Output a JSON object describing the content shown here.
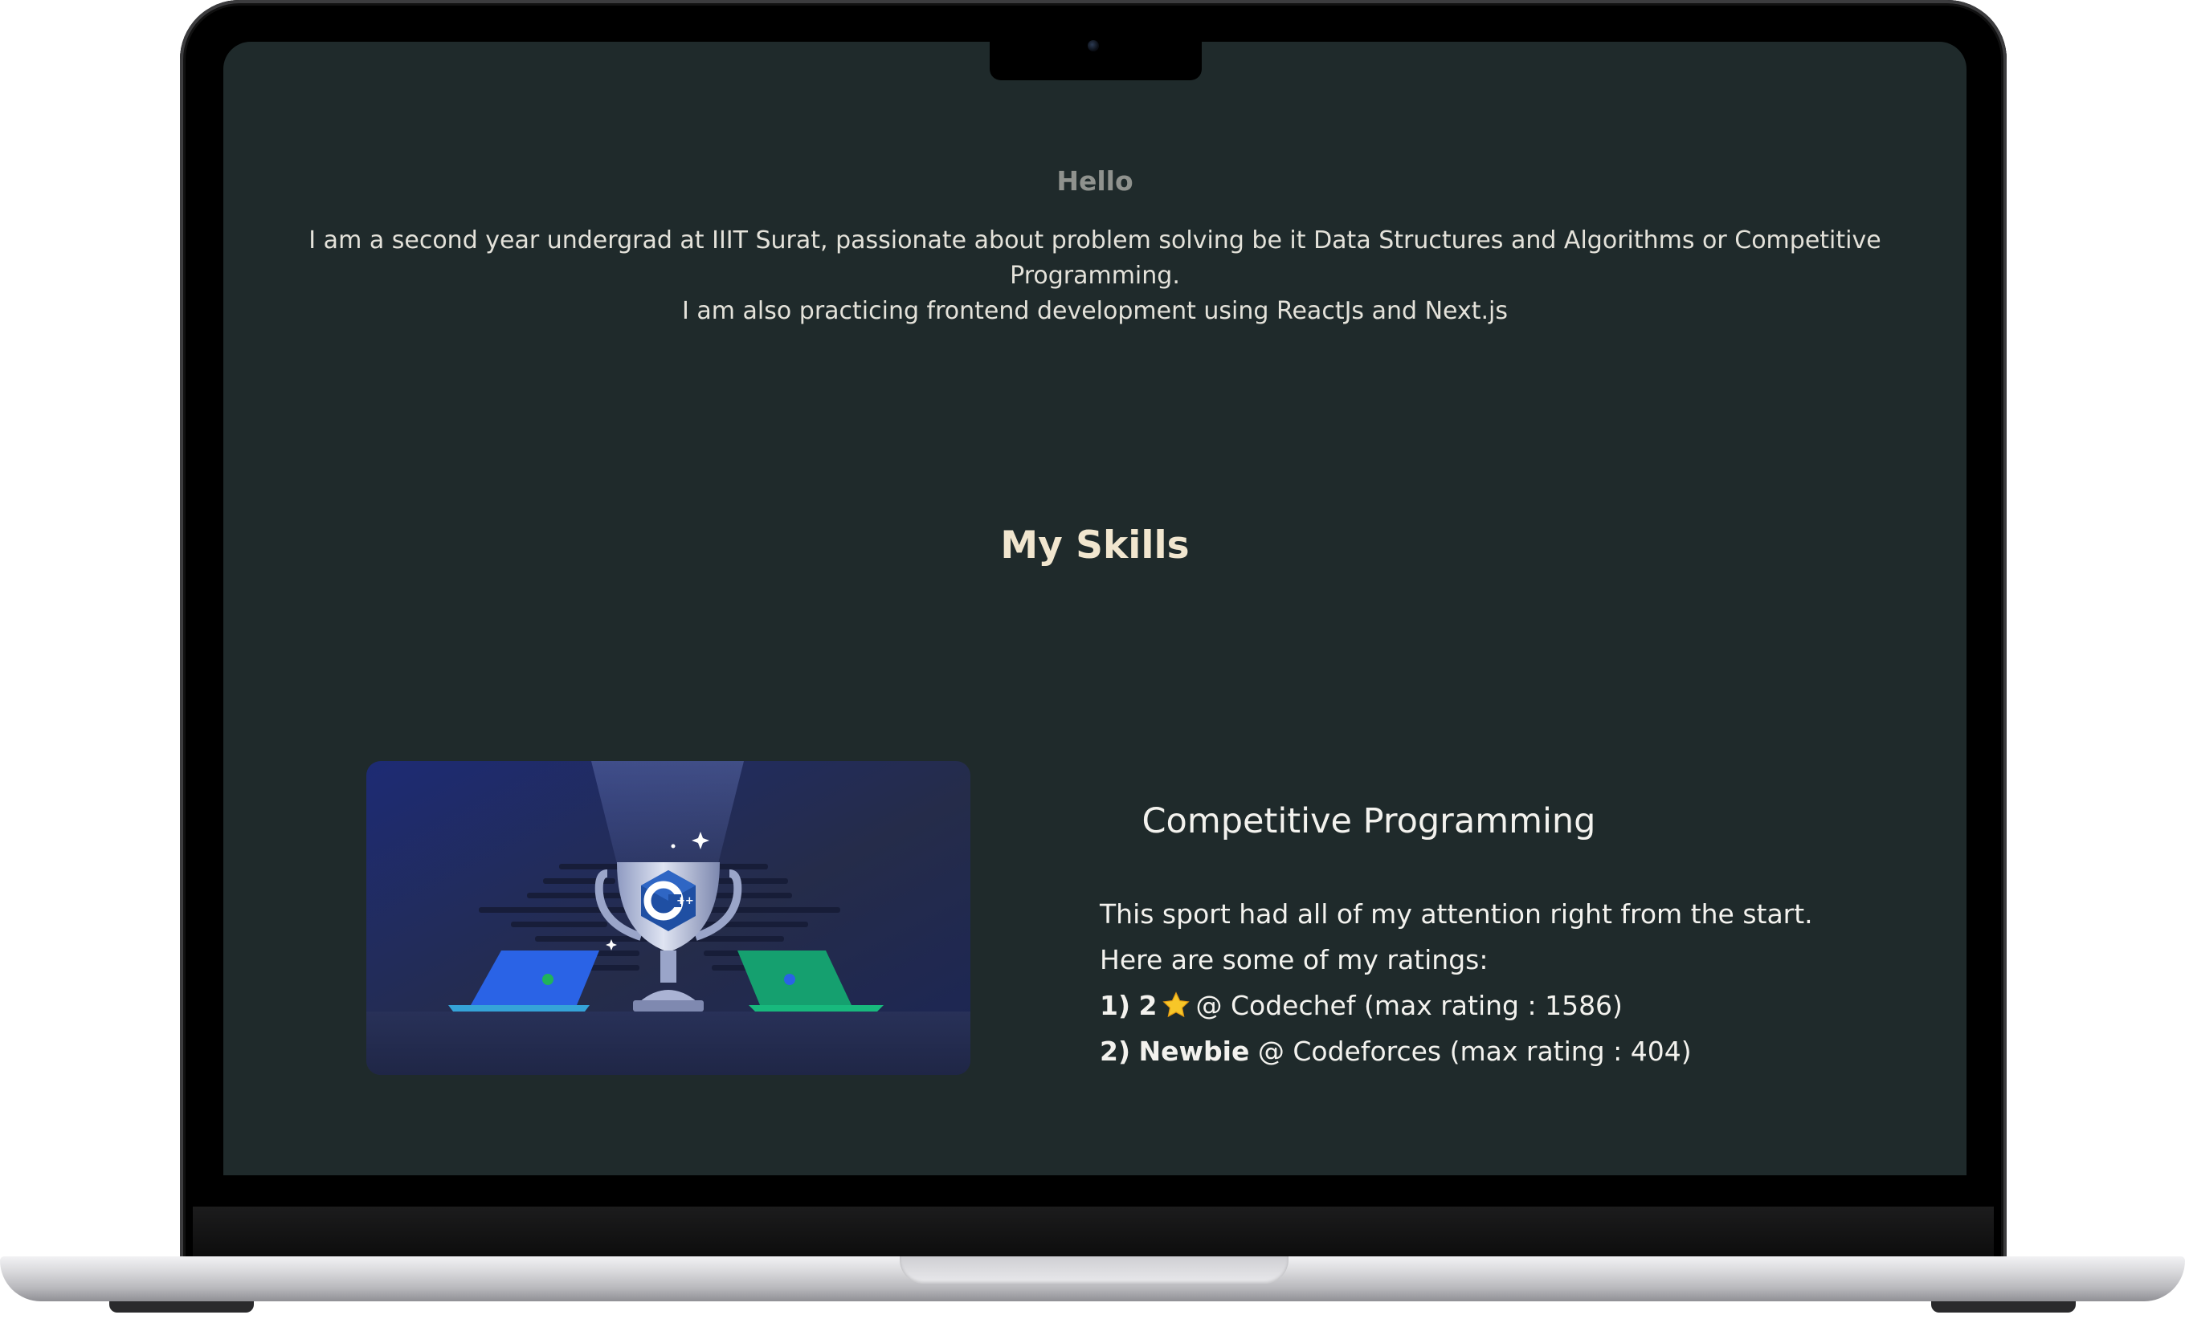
{
  "intro": {
    "heading": "Hello",
    "line1": "I am a second year undergrad at IIIT Surat, passionate about problem solving be it Data Structures and Algorithms or Competitive Programming.",
    "line2": "I am also practicing frontend development using ReactJs and Next.js"
  },
  "skills": {
    "title": "My Skills",
    "items": [
      {
        "name": "Competitive Programming",
        "image_icon": "cpp-trophy-illustration",
        "description_line1": "This sport had all of my attention right from the start.",
        "description_line2": "Here are some of my ratings:",
        "ratings": [
          {
            "index": "1)",
            "rank": "2",
            "rank_icon": "star-icon",
            "platform": "@ Codechef (max rating : 1586)"
          },
          {
            "index": "2)",
            "rank": "Newbie",
            "platform": "@ Codeforces (max rating : 404)"
          }
        ]
      }
    ]
  },
  "colors": {
    "page_background": "#1f2a2b",
    "heading_muted": "#8f928e",
    "skills_title": "#f1e6cf",
    "body_text": "#f3f2ee",
    "star": "#f7c628"
  }
}
